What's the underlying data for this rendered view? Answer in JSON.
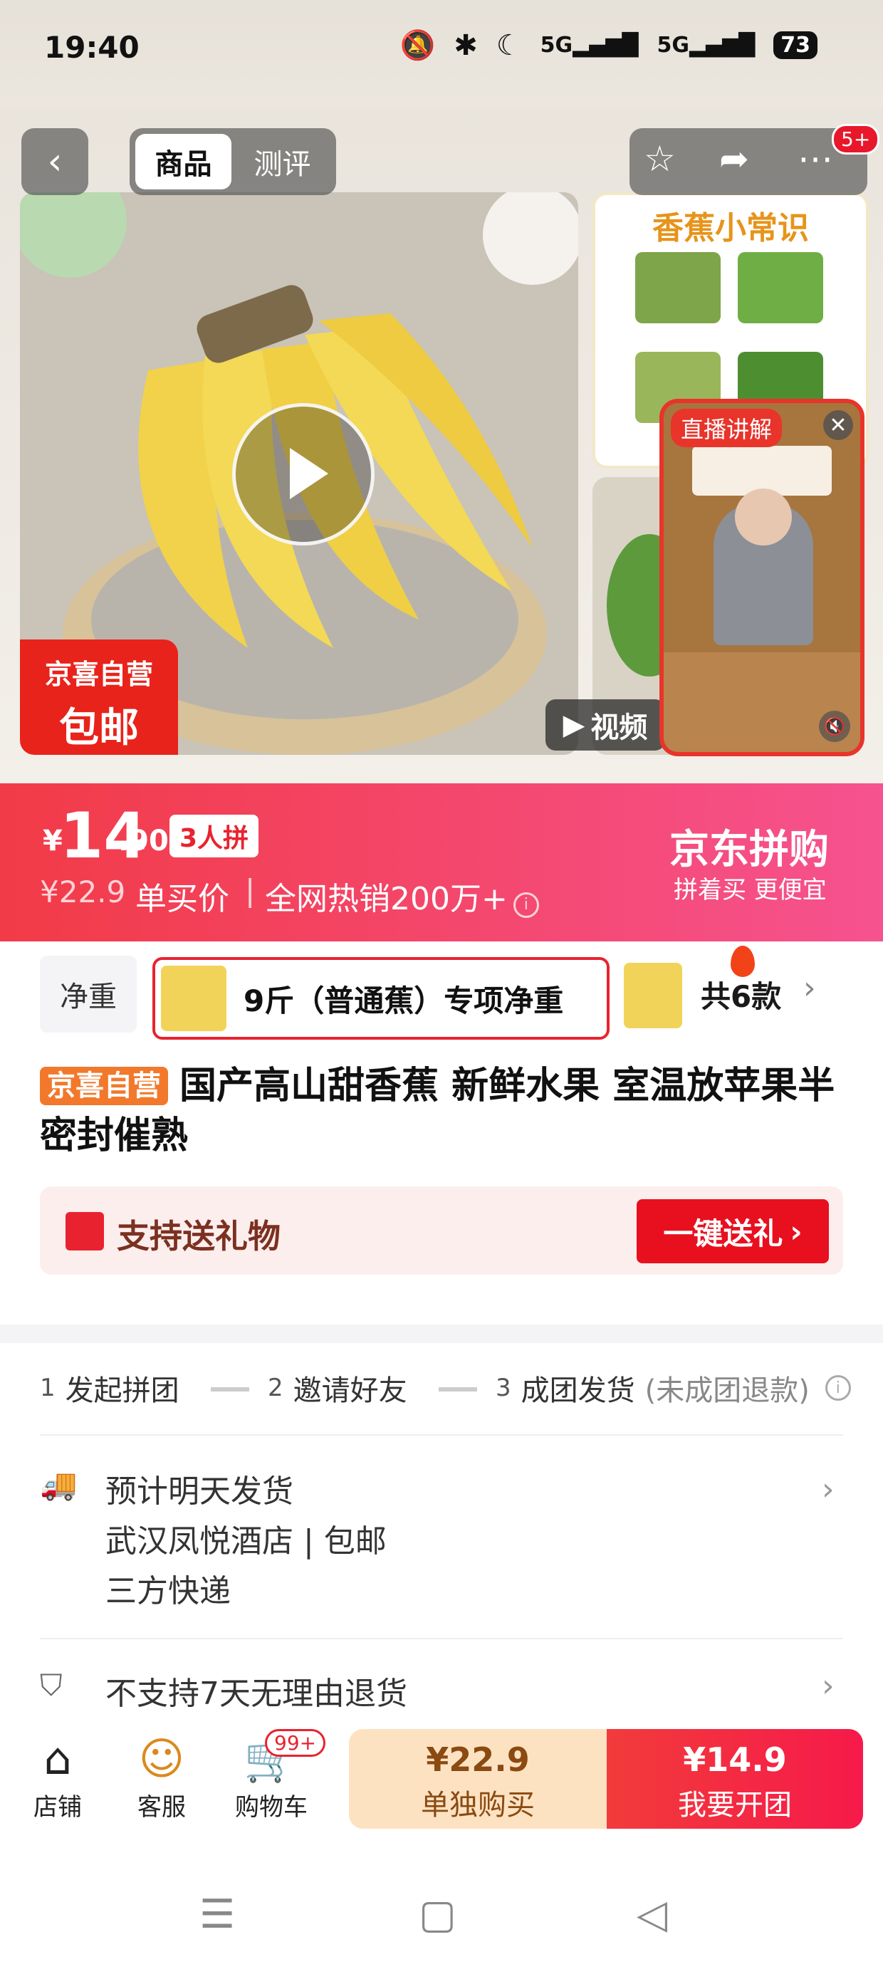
{
  "status_bar": {
    "time": "19:40",
    "battery": "73",
    "icons": [
      "mute-icon",
      "bluetooth-icon",
      "moon-icon",
      "signal-5g-icon",
      "signal-5g-icon"
    ]
  },
  "header": {
    "tabs": [
      {
        "label": "商品",
        "active": true
      },
      {
        "label": "测评",
        "active": false
      }
    ],
    "message_badge": "5+"
  },
  "gallery": {
    "badge_line1": "京喜自营",
    "badge_line2": "包邮",
    "thumb_title": "香蕉小常识",
    "video_label": "视频",
    "live_label": "直播讲解"
  },
  "price_banner": {
    "currency": "¥",
    "price_int": "14",
    "price_dec": ".90",
    "group_tag": "3人拼",
    "original_price": "¥22.9",
    "single_label": "单买价",
    "separator": "|",
    "sales": "全网热销200万+",
    "brand": "京东拼购",
    "slogan": "拼着买 更便宜"
  },
  "spec": {
    "label": "净重",
    "selected": "9斤（普通蕉）专项净重",
    "count": "共6款"
  },
  "product": {
    "tag": "京喜自营",
    "title": "国产高山甜香蕉 新鲜水果 室温放苹果半密封催熟"
  },
  "gift": {
    "text": "支持送礼物",
    "button": "一键送礼"
  },
  "steps": {
    "items": [
      {
        "num": "1",
        "label": "发起拼团"
      },
      {
        "num": "2",
        "label": "邀请好友"
      },
      {
        "num": "3",
        "label": "成团发货"
      }
    ],
    "note": "(未成团退款)"
  },
  "shipping": {
    "line1": "预计明天发货",
    "line2": "武汉凤悦酒店 | 包邮",
    "line3": "三方快递"
  },
  "return_policy": "不支持7天无理由退货",
  "bottom_bar": {
    "nav": [
      {
        "label": "店铺",
        "icon": "store-icon"
      },
      {
        "label": "客服",
        "icon": "customer-service-icon"
      },
      {
        "label": "购物车",
        "icon": "cart-icon"
      }
    ],
    "cart_badge": "99+",
    "single_price": "¥22.9",
    "single_label": "单独购买",
    "group_price": "¥14.9",
    "group_label": "我要开团"
  },
  "colors": {
    "accent_red": "#e8232f",
    "banner_pink": "#f6528f",
    "badge_orange": "#f2792b"
  }
}
